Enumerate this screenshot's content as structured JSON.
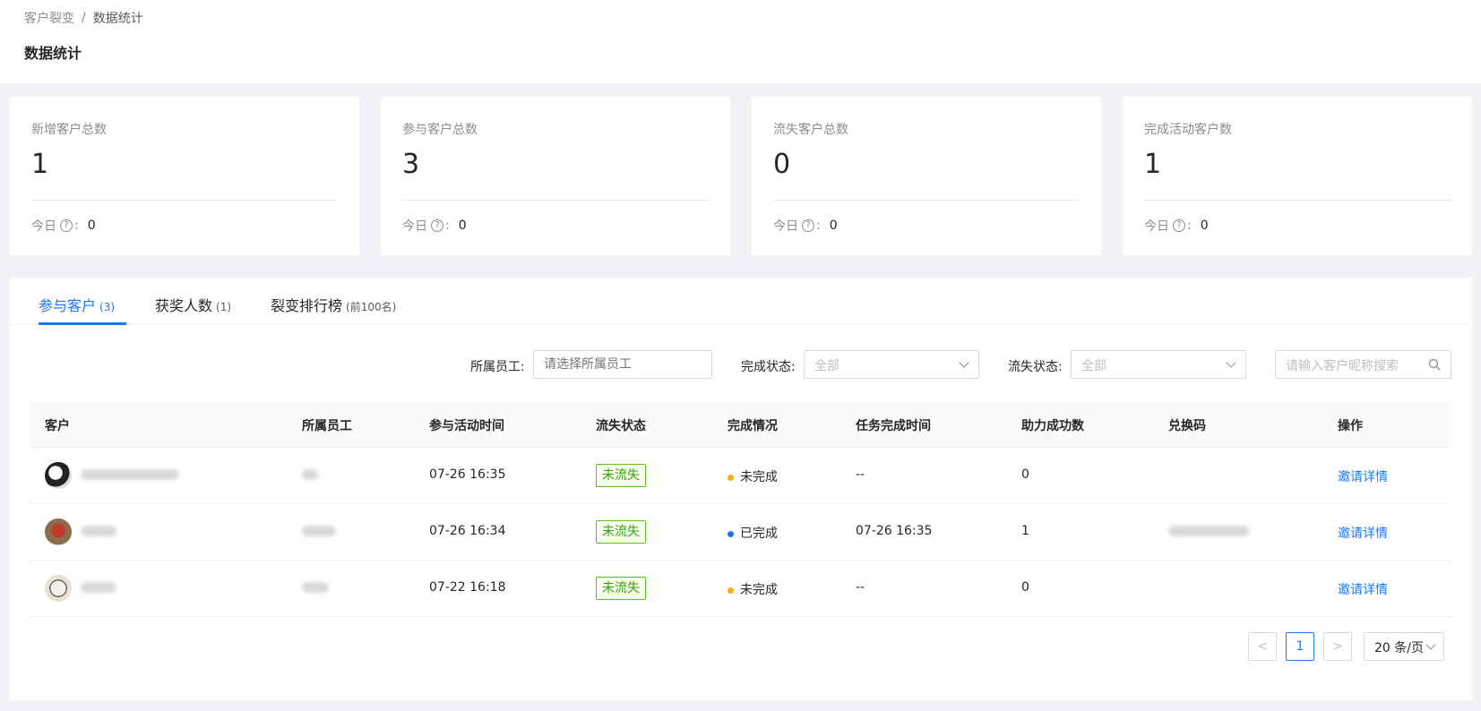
{
  "breadcrumb": {
    "parent": "客户裂变",
    "separator": "/",
    "current": "数据统计"
  },
  "page_title": "数据统计",
  "stats": [
    {
      "label": "新增客户总数",
      "value": "1",
      "today_label": "今日",
      "today_sep": ":",
      "today_value": "0"
    },
    {
      "label": "参与客户总数",
      "value": "3",
      "today_label": "今日",
      "today_sep": ":",
      "today_value": "0"
    },
    {
      "label": "流失客户总数",
      "value": "0",
      "today_label": "今日",
      "today_sep": ":",
      "today_value": "0"
    },
    {
      "label": "完成活动客户数",
      "value": "1",
      "today_label": "今日",
      "today_sep": ":",
      "today_value": "0"
    }
  ],
  "tabs": [
    {
      "label": "参与客户",
      "count": "(3)",
      "active": true
    },
    {
      "label": "获奖人数",
      "count": "(1)",
      "active": false
    },
    {
      "label": "裂变排行榜",
      "count": "(前100名)",
      "active": false
    }
  ],
  "filters": {
    "staff_label": "所属员工:",
    "staff_placeholder": "请选择所属员工",
    "complete_label": "完成状态:",
    "complete_value": "全部",
    "lost_label": "流失状态:",
    "lost_value": "全部",
    "search_placeholder": "请输入客户昵称搜索"
  },
  "table": {
    "columns": [
      "客户",
      "所属员工",
      "参与活动时间",
      "流失状态",
      "完成情况",
      "任务完成时间",
      "助力成功数",
      "兑换码",
      "操作"
    ],
    "rows": [
      {
        "join_time": "07-26 16:35",
        "lost": "未流失",
        "status": "未完成",
        "status_color": "#faad14",
        "done_time": "--",
        "assists": "0",
        "action": "邀请详情"
      },
      {
        "join_time": "07-26 16:34",
        "lost": "未流失",
        "status": "已完成",
        "status_color": "#1677ff",
        "done_time": "07-26 16:35",
        "assists": "1",
        "action": "邀请详情"
      },
      {
        "join_time": "07-22 16:18",
        "lost": "未流失",
        "status": "未完成",
        "status_color": "#faad14",
        "done_time": "--",
        "assists": "0",
        "action": "邀请详情"
      }
    ]
  },
  "pagination": {
    "prev": "<",
    "current": "1",
    "next": ">",
    "page_size": "20 条/页"
  },
  "colors": {
    "primary": "#1677ff",
    "success": "#52c41a",
    "warning": "#faad14"
  }
}
